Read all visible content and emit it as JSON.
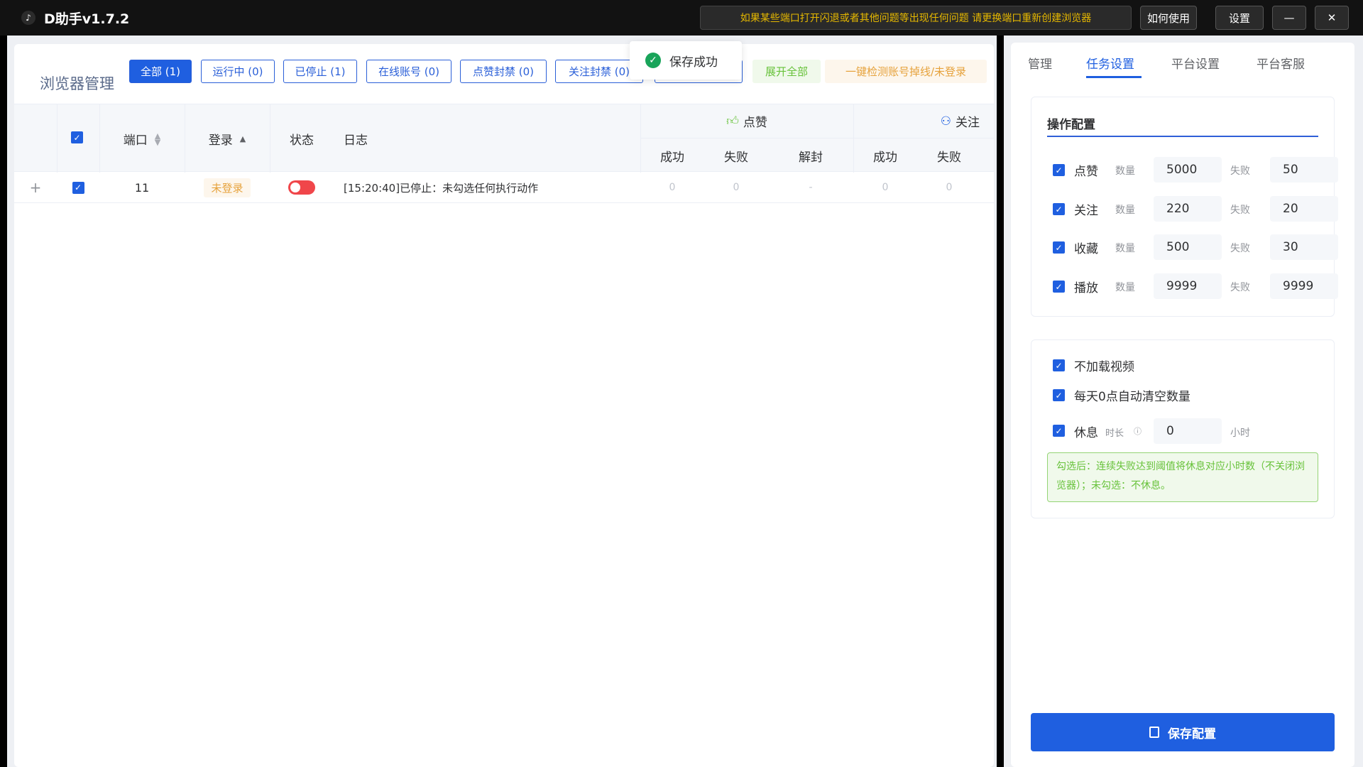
{
  "titlebar": {
    "app_title": "D助手v1.7.2",
    "notice": "如果某些端口打开闪退或者其他问题等出现任何问题 请更换端口重新创建浏览器",
    "how_to_use": "如何使用",
    "settings": "设置",
    "minimize": "—",
    "close": "✕"
  },
  "header": {
    "title": "浏览器管理",
    "filters": {
      "all": "全部 (1)",
      "running": "运行中 (0)",
      "stopped": "已停止 (1)",
      "online": "在线账号 (0)",
      "like_banned": "点赞封禁 (0)",
      "follow_banned": "关注封禁 (0)"
    },
    "expand_all": "展开全部",
    "check_accounts": "一键检测账号掉线/未登录"
  },
  "toast": {
    "text": "保存成功"
  },
  "table": {
    "columns": {
      "port": "端口",
      "login": "登录",
      "status": "状态",
      "log": "日志",
      "like_group": "点赞",
      "follow_group": "关注",
      "like_success": "成功",
      "like_fail": "失败",
      "like_unban": "解封",
      "follow_success": "成功",
      "follow_fail": "失败"
    },
    "rows": [
      {
        "expand": "+",
        "port": "11",
        "login": "未登录",
        "status_on": false,
        "log": "[15:20:40]已停止：未勾选任何执行动作",
        "like_success": "0",
        "like_fail": "0",
        "like_unban": "-",
        "follow_success": "0",
        "follow_fail": "0"
      }
    ]
  },
  "right_panel": {
    "tabs": {
      "manage": "管理",
      "task_settings": "任务设置",
      "platform_settings": "平台设置",
      "platform_service": "平台客服"
    },
    "config_title": "操作配置",
    "qty_label": "数量",
    "fail_label": "失败",
    "actions": [
      {
        "name": "点赞",
        "qty": "5000",
        "fail": "50",
        "checked": true
      },
      {
        "name": "关注",
        "qty": "220",
        "fail": "20",
        "checked": true
      },
      {
        "name": "收藏",
        "qty": "500",
        "fail": "30",
        "checked": true
      },
      {
        "name": "播放",
        "qty": "9999",
        "fail": "9999",
        "checked": true
      }
    ],
    "options": {
      "no_video": "不加载视频",
      "daily_reset": "每天0点自动清空数量",
      "rest": "休息",
      "rest_duration_label": "时长",
      "rest_value": "0",
      "rest_unit": "小时"
    },
    "tip": "勾选后：连续失败达到阈值将休息对应小时数（不关闭浏览器）；未勾选：不休息。",
    "save_button": "保存配置"
  },
  "colors": {
    "primary": "#1f5fe0",
    "success": "#67c23a",
    "warning": "#e6a23c",
    "danger": "#f0464a"
  }
}
